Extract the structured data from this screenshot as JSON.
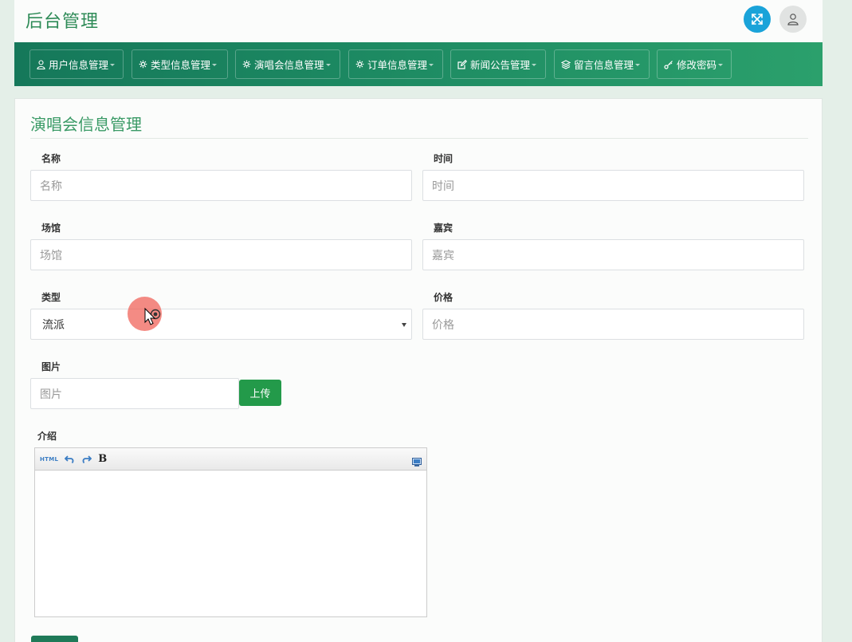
{
  "header": {
    "title": "后台管理",
    "expand_icon": "expand-icon",
    "user_icon": "user-icon",
    "accent_color": "#1aa3d9"
  },
  "nav": {
    "items": [
      {
        "label": "用户信息管理",
        "icon": "user-icon"
      },
      {
        "label": "类型信息管理",
        "icon": "gear-icon"
      },
      {
        "label": "演唱会信息管理",
        "icon": "gear-icon"
      },
      {
        "label": "订单信息管理",
        "icon": "gear-icon"
      },
      {
        "label": "新闻公告管理",
        "icon": "edit-icon"
      },
      {
        "label": "留言信息管理",
        "icon": "layers-icon"
      },
      {
        "label": "修改密码",
        "icon": "key-icon"
      }
    ],
    "bg_color": "#1e8c63"
  },
  "form": {
    "title": "演唱会信息管理",
    "fields": {
      "name": {
        "label": "名称",
        "placeholder": "名称"
      },
      "time": {
        "label": "时间",
        "placeholder": "时间"
      },
      "venue": {
        "label": "场馆",
        "placeholder": "场馆"
      },
      "guest": {
        "label": "嘉宾",
        "placeholder": "嘉宾"
      },
      "type": {
        "label": "类型",
        "value": "流派"
      },
      "price": {
        "label": "价格",
        "placeholder": "价格"
      },
      "image": {
        "label": "图片",
        "placeholder": "图片"
      },
      "intro": {
        "label": "介绍"
      }
    },
    "upload_label": "上传",
    "editor_toolbar": {
      "html_label": "HTML",
      "bold_label": "B",
      "undo_icon": "undo-icon",
      "redo_icon": "redo-icon",
      "fullscreen_icon": "fullscreen-icon"
    },
    "upload_color": "#239a4a"
  }
}
